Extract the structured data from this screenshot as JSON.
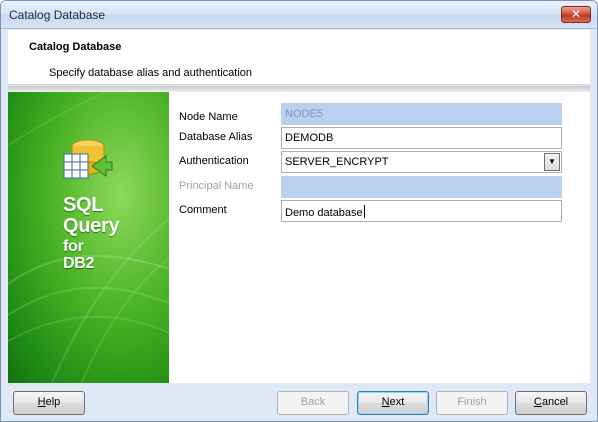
{
  "window": {
    "title": "Catalog Database",
    "close_glyph": "✕"
  },
  "header": {
    "title": "Catalog Database",
    "subtitle": "Specify database alias and authentication"
  },
  "brand": {
    "line1": "SQL",
    "line2": "Query",
    "line3": "for",
    "line4": "DB2"
  },
  "form": {
    "node_name": {
      "label": "Node Name",
      "value": "NODE5",
      "enabled": false
    },
    "database_alias": {
      "label": "Database Alias",
      "value": "DEMODB"
    },
    "authentication": {
      "label": "Authentication",
      "value": "SERVER_ENCRYPT"
    },
    "principal_name": {
      "label": "Principal Name",
      "value": "",
      "enabled": false
    },
    "comment": {
      "label": "Comment",
      "value": "Demo database"
    }
  },
  "buttons": {
    "help": {
      "hotkey": "H",
      "rest": "elp"
    },
    "back": {
      "label": "Back",
      "enabled": false
    },
    "next": {
      "hotkey": "N",
      "rest": "ext"
    },
    "finish": {
      "label": "Finish",
      "enabled": false
    },
    "cancel": {
      "hotkey": "C",
      "rest": "ancel"
    }
  },
  "colors": {
    "disabled_field": "#b9d1ef",
    "brand_green": "#49b324"
  }
}
